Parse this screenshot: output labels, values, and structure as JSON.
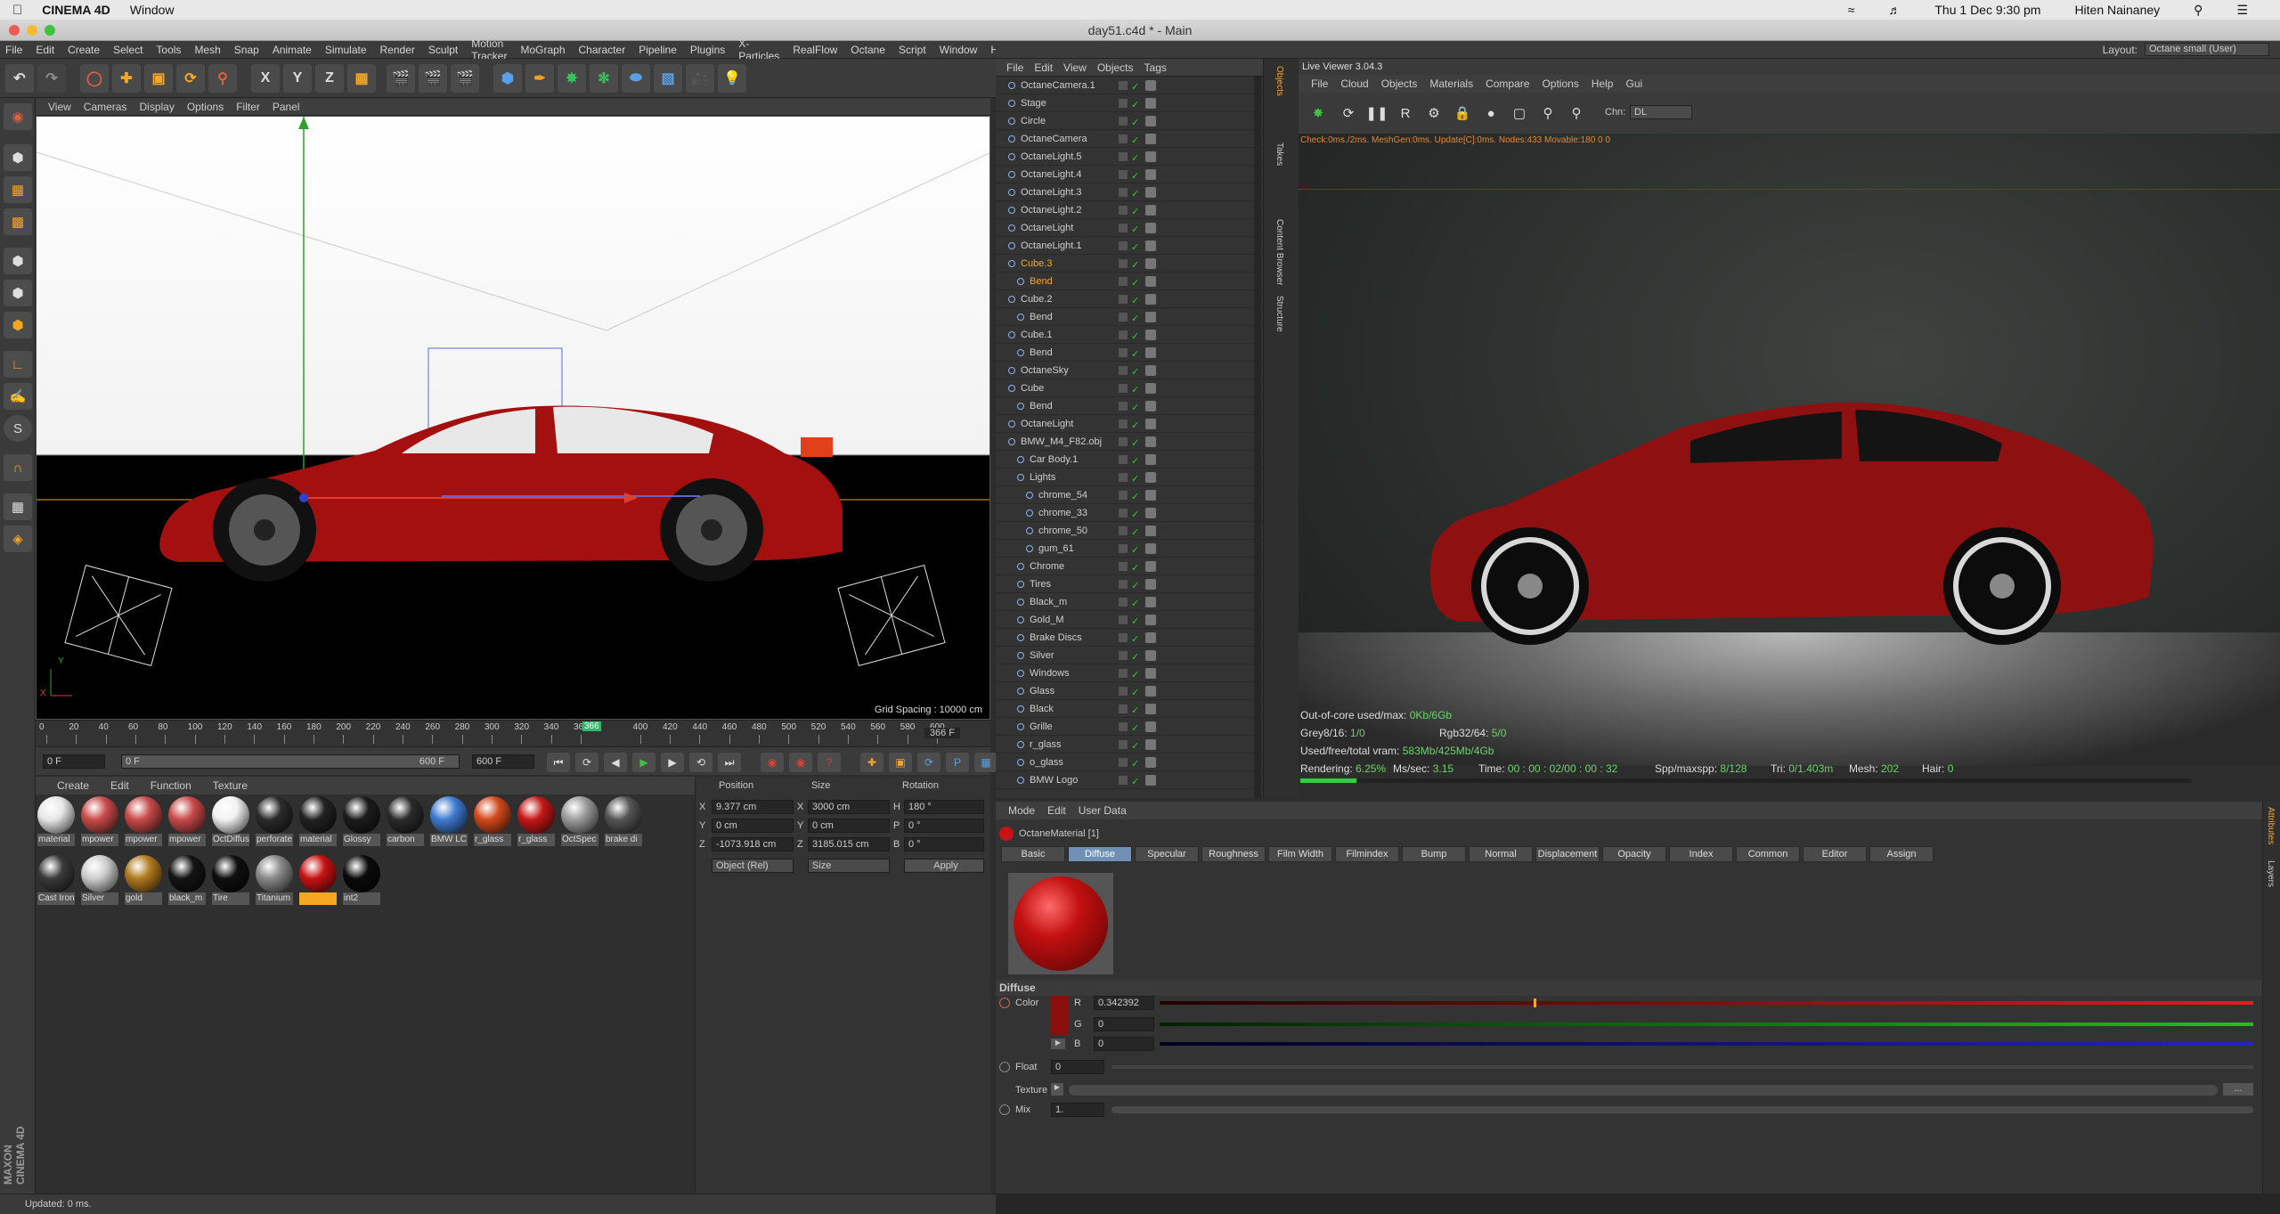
{
  "mac_menubar": {
    "items": [
      "CINEMA 4D",
      "Window"
    ],
    "datetime": "Thu 1 Dec  9:30 pm",
    "user": "Hiten Nainaney"
  },
  "window_title": "day51.c4d * - Main",
  "app_menu": [
    "File",
    "Edit",
    "Create",
    "Select",
    "Tools",
    "Mesh",
    "Snap",
    "Animate",
    "Simulate",
    "Render",
    "Sculpt",
    "Motion Tracker",
    "MoGraph",
    "Character",
    "Pipeline",
    "Plugins",
    "X-Particles",
    "RealFlow",
    "Octane",
    "Script",
    "Window",
    "Help"
  ],
  "layout": {
    "label": "Layout:",
    "value": "Octane small (User)"
  },
  "toolbar": {
    "axis_x": "X",
    "axis_y": "Y",
    "axis_z": "Z"
  },
  "viewport": {
    "menu": [
      "View",
      "Cameras",
      "Display",
      "Options",
      "Filter",
      "Panel"
    ],
    "grid_spacing": "Grid Spacing : 10000 cm",
    "axis_y": "Y",
    "axis_x": "X"
  },
  "timeline": {
    "ticks": [
      "0",
      "20",
      "40",
      "60",
      "80",
      "100",
      "120",
      "140",
      "160",
      "180",
      "200",
      "220",
      "240",
      "260",
      "280",
      "300",
      "320",
      "340",
      "360",
      "400",
      "420",
      "440",
      "460",
      "480",
      "500",
      "520",
      "540",
      "560",
      "580",
      "600"
    ],
    "current_marker": "366",
    "end_frame_label": "366 F"
  },
  "playbar": {
    "start": "0 F",
    "preview_start": "0 F",
    "preview_end": "600 F",
    "end": "600 F"
  },
  "material_manager": {
    "menu": [
      "Create",
      "Edit",
      "Function",
      "Texture"
    ],
    "materials": [
      {
        "name": "material",
        "color": "#e8e8e8"
      },
      {
        "name": "mpower",
        "color": "#c94a4a"
      },
      {
        "name": "mpower",
        "color": "#c94a4a"
      },
      {
        "name": "mpower",
        "color": "#c94a4a"
      },
      {
        "name": "OctDiffus",
        "color": "#f2f2f2"
      },
      {
        "name": "perforate",
        "color": "#2b2b2b"
      },
      {
        "name": "material",
        "color": "#222222"
      },
      {
        "name": "Glossy",
        "color": "#1c1c1c"
      },
      {
        "name": "carbon",
        "color": "#2a2a2a"
      },
      {
        "name": "BMW LC",
        "color": "#3f7bd1"
      },
      {
        "name": "r_glass",
        "color": "#d2481c"
      },
      {
        "name": "r_glass",
        "color": "#c41818"
      },
      {
        "name": "OctSpec",
        "color": "#9c9c9c"
      },
      {
        "name": "brake di",
        "color": "#555555"
      },
      {
        "name": "Cast Iron",
        "color": "#3a3a3a"
      },
      {
        "name": "Silver",
        "color": "#cfcfcf"
      },
      {
        "name": "gold",
        "color": "#b07a1e"
      },
      {
        "name": "black_m",
        "color": "#141414"
      },
      {
        "name": "Tire",
        "color": "#0f0f0f"
      },
      {
        "name": "Titanium",
        "color": "#8a8a8a"
      },
      {
        "name": "",
        "color": "#c71313"
      },
      {
        "name": "int2",
        "color": "#0a0a0a"
      }
    ]
  },
  "coordinates": {
    "headers": [
      "Position",
      "Size",
      "Rotation"
    ],
    "rows": [
      {
        "a": "X",
        "pos": "9.377 cm",
        "b": "X",
        "size": "3000 cm",
        "c": "H",
        "rot": "180 °"
      },
      {
        "a": "Y",
        "pos": "0 cm",
        "b": "Y",
        "size": "0 cm",
        "c": "P",
        "rot": "0 °"
      },
      {
        "a": "Z",
        "pos": "-1073.918 cm",
        "b": "Z",
        "size": "3185.015 cm",
        "c": "B",
        "rot": "0 °"
      }
    ],
    "mode": "Object (Rel)",
    "size_mode": "Size",
    "apply": "Apply"
  },
  "object_manager": {
    "menu": [
      "File",
      "Edit",
      "View",
      "Objects",
      "Tags"
    ],
    "objects": [
      {
        "name": "OctaneCamera.1",
        "indent": 0,
        "hl": false
      },
      {
        "name": "Stage",
        "indent": 0,
        "hl": false
      },
      {
        "name": "Circle",
        "indent": 0,
        "hl": false
      },
      {
        "name": "OctaneCamera",
        "indent": 0,
        "hl": false
      },
      {
        "name": "OctaneLight.5",
        "indent": 0,
        "hl": false
      },
      {
        "name": "OctaneLight.4",
        "indent": 0,
        "hl": false
      },
      {
        "name": "OctaneLight.3",
        "indent": 0,
        "hl": false
      },
      {
        "name": "OctaneLight.2",
        "indent": 0,
        "hl": false
      },
      {
        "name": "OctaneLight",
        "indent": 0,
        "hl": false
      },
      {
        "name": "OctaneLight.1",
        "indent": 0,
        "hl": false
      },
      {
        "name": "Cube.3",
        "indent": 0,
        "hl": true
      },
      {
        "name": "Bend",
        "indent": 1,
        "hl": true
      },
      {
        "name": "Cube.2",
        "indent": 0,
        "hl": false
      },
      {
        "name": "Bend",
        "indent": 1,
        "hl": false
      },
      {
        "name": "Cube.1",
        "indent": 0,
        "hl": false
      },
      {
        "name": "Bend",
        "indent": 1,
        "hl": false
      },
      {
        "name": "OctaneSky",
        "indent": 0,
        "hl": false
      },
      {
        "name": "Cube",
        "indent": 0,
        "hl": false
      },
      {
        "name": "Bend",
        "indent": 1,
        "hl": false
      },
      {
        "name": "OctaneLight",
        "indent": 0,
        "hl": false
      },
      {
        "name": "BMW_M4_F82.obj",
        "indent": 0,
        "hl": false
      },
      {
        "name": "Car Body.1",
        "indent": 1,
        "hl": false
      },
      {
        "name": "Lights",
        "indent": 1,
        "hl": false
      },
      {
        "name": "chrome_54",
        "indent": 2,
        "hl": false
      },
      {
        "name": "chrome_33",
        "indent": 2,
        "hl": false
      },
      {
        "name": "chrome_50",
        "indent": 2,
        "hl": false
      },
      {
        "name": "gum_61",
        "indent": 2,
        "hl": false
      },
      {
        "name": "Chrome",
        "indent": 1,
        "hl": false
      },
      {
        "name": "Tires",
        "indent": 1,
        "hl": false
      },
      {
        "name": "Black_m",
        "indent": 1,
        "hl": false
      },
      {
        "name": "Gold_M",
        "indent": 1,
        "hl": false
      },
      {
        "name": "Brake Discs",
        "indent": 1,
        "hl": false
      },
      {
        "name": "Silver",
        "indent": 1,
        "hl": false
      },
      {
        "name": "Windows",
        "indent": 1,
        "hl": false
      },
      {
        "name": "Glass",
        "indent": 1,
        "hl": false
      },
      {
        "name": "Black",
        "indent": 1,
        "hl": false
      },
      {
        "name": "Grille",
        "indent": 1,
        "hl": false
      },
      {
        "name": "r_glass",
        "indent": 1,
        "hl": false
      },
      {
        "name": "o_glass",
        "indent": 1,
        "hl": false
      },
      {
        "name": "BMW Logo",
        "indent": 1,
        "hl": false
      }
    ]
  },
  "side_tabs": [
    "Objects",
    "Takes",
    "Content Browser",
    "Structure"
  ],
  "live_viewer": {
    "title": "Live Viewer 3.04.3",
    "menu": [
      "File",
      "Cloud",
      "Objects",
      "Materials",
      "Compare",
      "Options",
      "Help",
      "Gui"
    ],
    "channel_label": "Chn:",
    "channel_value": "DL",
    "status_line": "Check:0ms./2ms. MeshGen:0ms. Update[C]:0ms. Nodes:433 Movable:180  0 0",
    "out_of_core": {
      "label": "Out-of-core used/max:",
      "value": "0Kb/6Gb"
    },
    "grey": {
      "label": "Grey8/16:",
      "value": "1/0"
    },
    "rgb": {
      "label": "Rgb32/64:",
      "value": "5/0"
    },
    "vram": {
      "label": "Used/free/total vram:",
      "value": "583Mb/425Mb/4Gb"
    },
    "rendering": {
      "label": "Rendering:",
      "value": "6.25%"
    },
    "mssec": {
      "label": "Ms/sec:",
      "value": "3.15"
    },
    "time": {
      "label": "Time:",
      "value": "00 : 00 : 02/00 : 00 : 32"
    },
    "spp": {
      "label": "Spp/maxspp:",
      "value": "8/128"
    },
    "tri": {
      "label": "Tri:",
      "value": "0/1.403m"
    },
    "mesh": {
      "label": "Mesh:",
      "value": "202"
    },
    "hair": {
      "label": "Hair:",
      "value": "0"
    },
    "progress": 0.0625
  },
  "attribute_manager": {
    "menu": [
      "Mode",
      "Edit",
      "User Data"
    ],
    "material_name": "OctaneMaterial [1]",
    "tabs": [
      "Basic",
      "Diffuse",
      "Specular",
      "Roughness",
      "Film Width",
      "Filmindex",
      "Bump",
      "Normal",
      "Displacement",
      "Opacity",
      "Index",
      "Common",
      "Editor",
      "Assign"
    ],
    "active_tab": "Diffuse",
    "section": "Diffuse",
    "color_label": "Color",
    "r_label": "R",
    "r_value": "0.342392",
    "r_fraction": 0.342392,
    "g_label": "G",
    "g_value": "0",
    "b_label": "B",
    "b_value": "0",
    "float_label": "Float",
    "float_value": "0",
    "texture_label": "Texture",
    "mix_label": "Mix",
    "mix_value": "1."
  },
  "side_tabs_right": [
    "Attributes",
    "Layers"
  ],
  "status": "Updated: 0 ms.",
  "maxon_logo": "MAXON CINEMA 4D"
}
